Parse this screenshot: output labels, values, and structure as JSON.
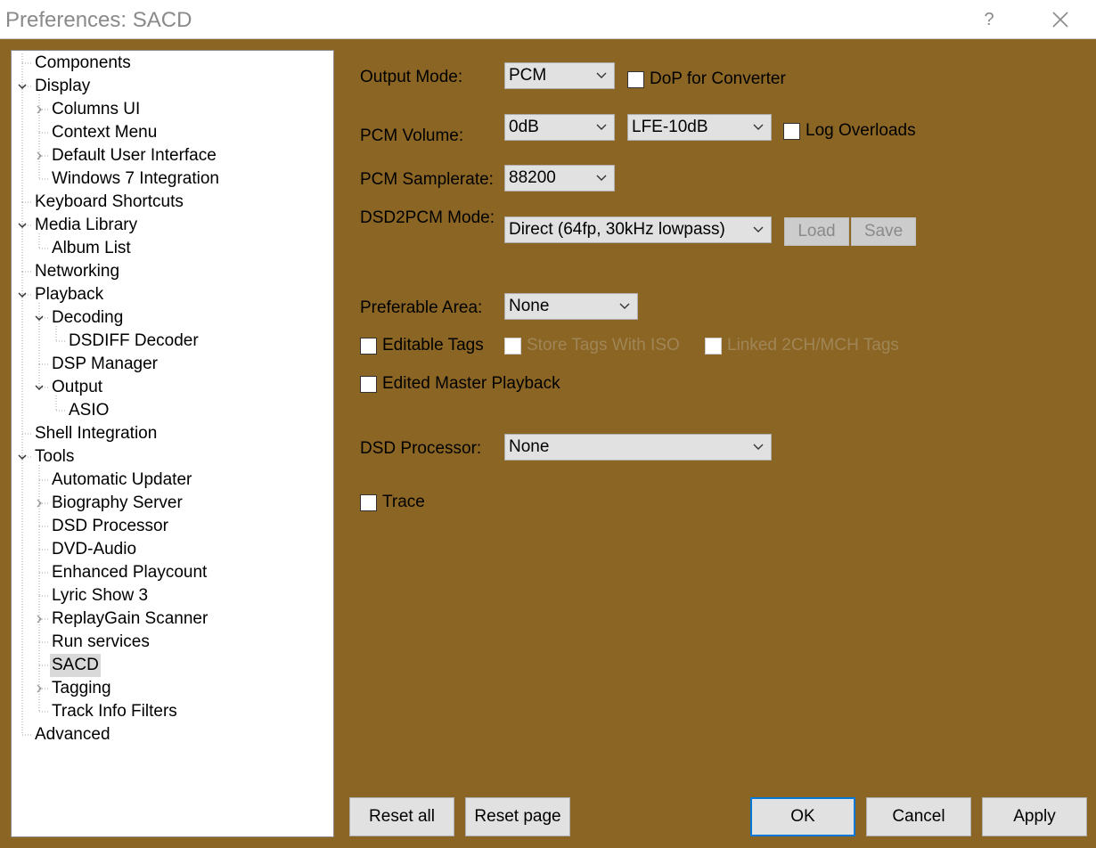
{
  "window": {
    "title": "Preferences: SACD",
    "help_label": "?",
    "close_icon": "close-icon"
  },
  "tree": {
    "items": [
      {
        "label": "Components",
        "level": 0,
        "expander": "none"
      },
      {
        "label": "Display",
        "level": 0,
        "expander": "expanded"
      },
      {
        "label": "Columns UI",
        "level": 1,
        "expander": "collapsed"
      },
      {
        "label": "Context Menu",
        "level": 1,
        "expander": "none"
      },
      {
        "label": "Default User Interface",
        "level": 1,
        "expander": "collapsed"
      },
      {
        "label": "Windows 7 Integration",
        "level": 1,
        "expander": "none"
      },
      {
        "label": "Keyboard Shortcuts",
        "level": 0,
        "expander": "none"
      },
      {
        "label": "Media Library",
        "level": 0,
        "expander": "expanded"
      },
      {
        "label": "Album List",
        "level": 1,
        "expander": "none"
      },
      {
        "label": "Networking",
        "level": 0,
        "expander": "none"
      },
      {
        "label": "Playback",
        "level": 0,
        "expander": "expanded"
      },
      {
        "label": "Decoding",
        "level": 1,
        "expander": "expanded"
      },
      {
        "label": "DSDIFF Decoder",
        "level": 2,
        "expander": "none"
      },
      {
        "label": "DSP Manager",
        "level": 1,
        "expander": "none"
      },
      {
        "label": "Output",
        "level": 1,
        "expander": "expanded"
      },
      {
        "label": "ASIO",
        "level": 2,
        "expander": "none"
      },
      {
        "label": "Shell Integration",
        "level": 0,
        "expander": "none"
      },
      {
        "label": "Tools",
        "level": 0,
        "expander": "expanded"
      },
      {
        "label": "Automatic Updater",
        "level": 1,
        "expander": "none"
      },
      {
        "label": "Biography Server",
        "level": 1,
        "expander": "collapsed"
      },
      {
        "label": "DSD Processor",
        "level": 1,
        "expander": "none"
      },
      {
        "label": "DVD-Audio",
        "level": 1,
        "expander": "none"
      },
      {
        "label": "Enhanced Playcount",
        "level": 1,
        "expander": "none"
      },
      {
        "label": "Lyric Show 3",
        "level": 1,
        "expander": "none"
      },
      {
        "label": "ReplayGain Scanner",
        "level": 1,
        "expander": "collapsed"
      },
      {
        "label": "Run services",
        "level": 1,
        "expander": "none"
      },
      {
        "label": "SACD",
        "level": 1,
        "expander": "none",
        "selected": true
      },
      {
        "label": "Tagging",
        "level": 1,
        "expander": "collapsed"
      },
      {
        "label": "Track Info Filters",
        "level": 1,
        "expander": "none"
      },
      {
        "label": "Advanced",
        "level": 0,
        "expander": "none"
      }
    ]
  },
  "settings": {
    "output_mode": {
      "label": "Output Mode:",
      "value": "PCM"
    },
    "dop_converter": {
      "label": "DoP for Converter",
      "checked": false
    },
    "pcm_volume": {
      "label": "PCM Volume:",
      "value": "0dB"
    },
    "lfe_volume": {
      "value": "LFE-10dB"
    },
    "log_overloads": {
      "label": "Log Overloads",
      "checked": false
    },
    "pcm_samplerate": {
      "label": "PCM Samplerate:",
      "value": "88200"
    },
    "dsd2pcm_mode": {
      "label": "DSD2PCM Mode:",
      "value": "Direct (64fp, 30kHz lowpass)"
    },
    "load_button": "Load",
    "save_button": "Save",
    "preferable_area": {
      "label": "Preferable Area:",
      "value": "None"
    },
    "editable_tags": {
      "label": "Editable Tags",
      "checked": false
    },
    "store_tags_iso": {
      "label": "Store Tags With ISO",
      "checked": false,
      "disabled": true
    },
    "linked_tags": {
      "label": "Linked 2CH/MCH Tags",
      "checked": false,
      "disabled": true
    },
    "edited_master": {
      "label": "Edited Master Playback",
      "checked": false
    },
    "dsd_processor": {
      "label": "DSD Processor:",
      "value": "None"
    },
    "trace": {
      "label": "Trace",
      "checked": false
    }
  },
  "footer": {
    "reset_all": "Reset all",
    "reset_page": "Reset page",
    "ok": "OK",
    "cancel": "Cancel",
    "apply": "Apply"
  },
  "colors": {
    "background": "#8b6524",
    "accent": "#0078d7",
    "selection": "#d9d9d9"
  }
}
